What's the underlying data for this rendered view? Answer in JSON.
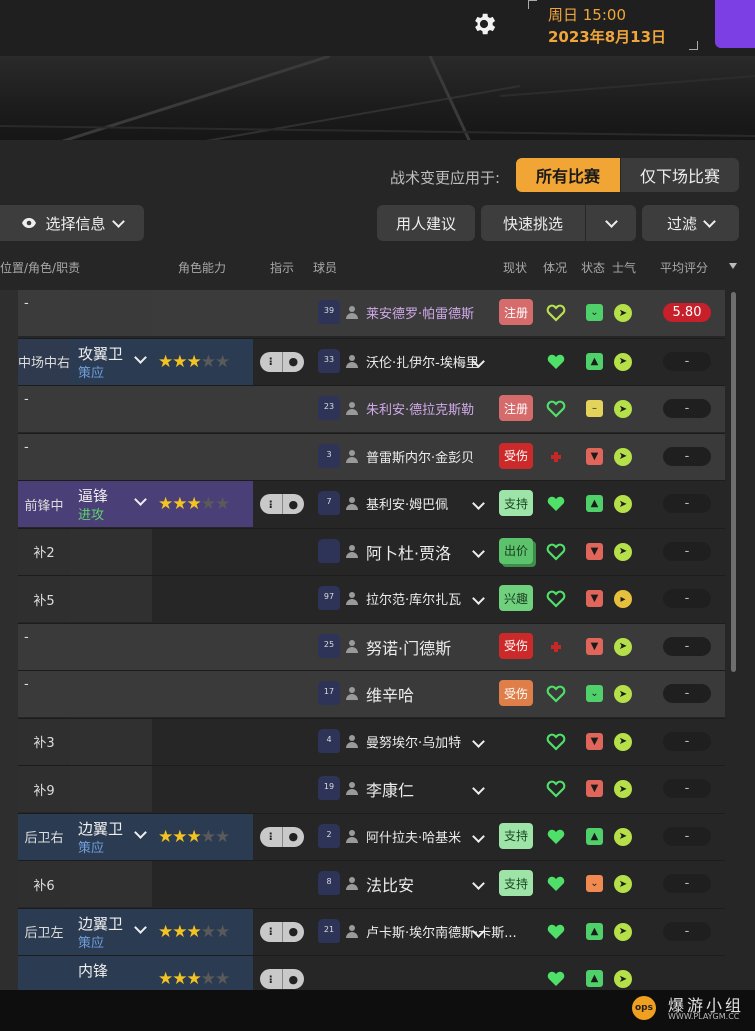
{
  "header": {
    "date_day": "周日 15:00",
    "date_full": "2023年8月13日"
  },
  "tactics": {
    "apply_label": "战术变更应用于:",
    "all_matches": "所有比赛",
    "next_match": "仅下场比赛"
  },
  "toolbar": {
    "select_info": "选择信息",
    "advice": "用人建议",
    "quick_pick": "快速挑选",
    "filter": "过滤"
  },
  "columns": {
    "position": "位置/角色/职责",
    "ability": "角色能力",
    "instructions": "指示",
    "player": "球员",
    "status": "现状",
    "fitness": "体况",
    "condition": "状态",
    "morale": "士气",
    "avg_rating": "平均评分"
  },
  "rows": [
    {
      "pos": "-",
      "role": "",
      "duty": "",
      "stars": 0,
      "num": "39",
      "name": "莱安德罗·帕雷德斯",
      "status": "注册",
      "status_type": "reg",
      "fitness": "mid",
      "cond": "ok",
      "morale": "ok",
      "rating": "5.80"
    },
    {
      "pos": "中场中右",
      "role": "攻翼卫",
      "duty": "策应",
      "stars": 3,
      "num": "33",
      "name": "沃伦·扎伊尔-埃梅里",
      "status": "",
      "status_type": "",
      "fitness": "full",
      "cond": "up",
      "morale": "ok",
      "rating": "-"
    },
    {
      "pos": "-",
      "role": "",
      "duty": "",
      "stars": 0,
      "num": "23",
      "name": "朱利安·德拉克斯勒",
      "status": "注册",
      "status_type": "reg",
      "fitness": "mid",
      "cond": "flat",
      "morale": "ok",
      "rating": "-"
    },
    {
      "pos": "-",
      "role": "",
      "duty": "",
      "stars": 0,
      "num": "3",
      "name": "普雷斯内尔·金彭贝",
      "status": "受伤",
      "status_type": "inj",
      "fitness": "inj",
      "cond": "down",
      "morale": "ok",
      "rating": "-"
    },
    {
      "pos": "前锋中",
      "role": "逼锋",
      "duty": "进攻",
      "stars": 3,
      "num": "7",
      "name": "基利安·姆巴佩",
      "status": "支持",
      "status_type": "sup",
      "fitness": "full",
      "cond": "up",
      "morale": "ok",
      "rating": "-"
    },
    {
      "pos": "补2",
      "role": "",
      "duty": "",
      "stars": 0,
      "num": "",
      "name": "阿卜杜·贾洛",
      "status": "出价",
      "status_type": "bid",
      "fitness": "mid",
      "cond": "down",
      "morale": "ok",
      "rating": "-"
    },
    {
      "pos": "补5",
      "role": "",
      "duty": "",
      "stars": 0,
      "num": "97",
      "name": "拉尔范·库尔扎瓦",
      "status": "兴趣",
      "status_type": "int",
      "fitness": "mid",
      "cond": "down",
      "morale": "low",
      "rating": "-"
    },
    {
      "pos": "-",
      "role": "",
      "duty": "",
      "stars": 0,
      "num": "25",
      "name": "努诺·门德斯",
      "status": "受伤",
      "status_type": "inj",
      "fitness": "inj",
      "cond": "down",
      "morale": "ok",
      "rating": "-"
    },
    {
      "pos": "-",
      "role": "",
      "duty": "",
      "stars": 0,
      "num": "17",
      "name": "维辛哈",
      "status": "受伤",
      "status_type": "inj2",
      "fitness": "mid",
      "cond": "ok",
      "morale": "ok",
      "rating": "-"
    },
    {
      "pos": "补3",
      "role": "",
      "duty": "",
      "stars": 0,
      "num": "4",
      "name": "曼努埃尔·乌加特",
      "status": "",
      "status_type": "",
      "fitness": "mid",
      "cond": "down",
      "morale": "ok",
      "rating": "-"
    },
    {
      "pos": "补9",
      "role": "",
      "duty": "",
      "stars": 0,
      "num": "19",
      "name": "李康仁",
      "status": "",
      "status_type": "",
      "fitness": "mid",
      "cond": "down",
      "morale": "ok",
      "rating": "-"
    },
    {
      "pos": "后卫右",
      "role": "边翼卫",
      "duty": "策应",
      "stars": 3,
      "num": "2",
      "name": "阿什拉夫·哈基米",
      "status": "支持",
      "status_type": "sup",
      "fitness": "full",
      "cond": "up",
      "morale": "ok",
      "rating": "-"
    },
    {
      "pos": "补6",
      "role": "",
      "duty": "",
      "stars": 0,
      "num": "8",
      "name": "法比安",
      "status": "支持",
      "status_type": "sup",
      "fitness": "full",
      "cond": "dn2",
      "morale": "ok",
      "rating": "-"
    },
    {
      "pos": "后卫左",
      "role": "边翼卫",
      "duty": "策应",
      "stars": 3,
      "num": "21",
      "name": "卢卡斯·埃尔南德斯·卡斯...",
      "status": "",
      "status_type": "",
      "fitness": "full",
      "cond": "up",
      "morale": "ok",
      "rating": "-"
    },
    {
      "pos": "",
      "role": "内锋",
      "duty": "",
      "stars": 3,
      "num": "",
      "name": "",
      "status": "",
      "status_type": "",
      "fitness": "full",
      "cond": "up",
      "morale": "ok",
      "rating": ""
    }
  ],
  "watermark": {
    "text": "爆游小组",
    "url": "WWW.PLAYGM.CC",
    "badge": "ops"
  },
  "colors": {
    "accent": "#f1a535",
    "purple": "#7b3fe4",
    "fitness": "#4fe06a",
    "role_strike": "#4b3f78",
    "role_def": "#2b3b52"
  }
}
